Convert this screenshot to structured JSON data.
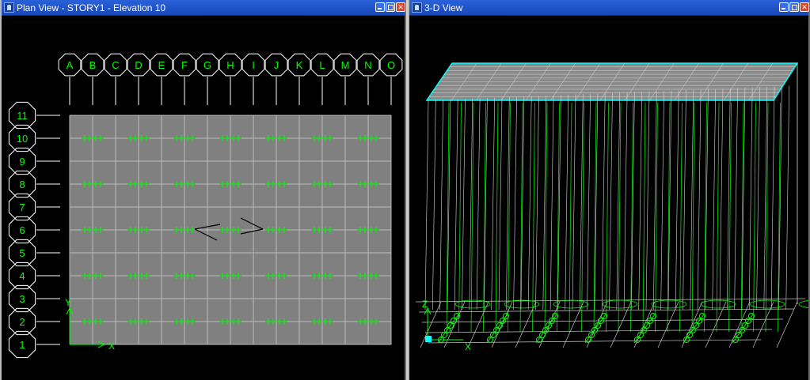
{
  "left_window": {
    "title": "Plan View - STORY1 - Elevation 10",
    "column_labels": [
      "A",
      "B",
      "C",
      "D",
      "E",
      "F",
      "G",
      "H",
      "I",
      "J",
      "K",
      "L",
      "M",
      "N",
      "O"
    ],
    "row_labels": [
      "11",
      "10",
      "9",
      "8",
      "7",
      "6",
      "5",
      "4",
      "3",
      "2",
      "1"
    ],
    "axis_x": "X",
    "axis_y": "Y"
  },
  "right_window": {
    "title": "3-D View",
    "axis_x": "X",
    "axis_z": "Z"
  },
  "colors": {
    "grid_label": "#00ff00",
    "slab_fill": "#808080",
    "slab_outline": "#00ffff",
    "title_bar": "#1f55c8"
  }
}
